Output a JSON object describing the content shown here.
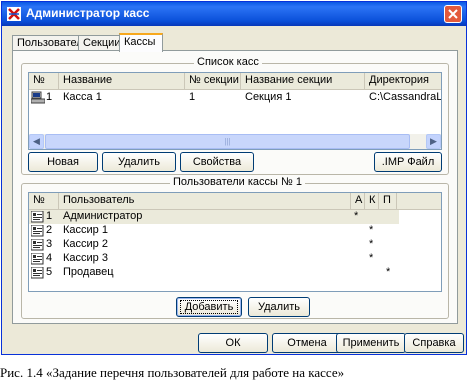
{
  "window": {
    "title": "Администратор касс"
  },
  "tabs": [
    {
      "label": "Пользователи"
    },
    {
      "label": "Секции"
    },
    {
      "label": "Кассы"
    }
  ],
  "kassy_group": {
    "title": "Список касс",
    "columns": [
      "№",
      "Название",
      "№ секции",
      "Название секции",
      "Директория"
    ],
    "rows": [
      {
        "num": "1",
        "name": "Касса 1",
        "section_num": "1",
        "section_name": "Секция 1",
        "directory": "C:\\CassandraLig"
      }
    ],
    "buttons": {
      "new": "Новая",
      "delete": "Удалить",
      "properties": "Свойства",
      "imp_file": ".IMP Файл"
    }
  },
  "users_group": {
    "title": "Пользователи кассы № 1",
    "columns": [
      "№",
      "Пользователь",
      "А",
      "К",
      "П"
    ],
    "rows": [
      {
        "num": "1",
        "name": "Администратор",
        "a": "*",
        "k": "",
        "p": ""
      },
      {
        "num": "2",
        "name": "Кассир 1",
        "a": "",
        "k": "*",
        "p": ""
      },
      {
        "num": "3",
        "name": "Кассир 2",
        "a": "",
        "k": "*",
        "p": ""
      },
      {
        "num": "4",
        "name": "Кассир 3",
        "a": "",
        "k": "*",
        "p": ""
      },
      {
        "num": "5",
        "name": "Продавец",
        "a": "",
        "k": "",
        "p": "*"
      }
    ],
    "buttons": {
      "add": "Добавить",
      "delete": "Удалить"
    }
  },
  "dialog_buttons": {
    "ok": "ОК",
    "cancel": "Отмена",
    "apply": "Применить",
    "help": "Справка"
  },
  "caption": "Рис. 1.4 «Задание перечня пользователей для работе на кассе»",
  "colors": {
    "titlebar": "#0a58e4",
    "selection": "#ebeadb",
    "face": "#ece9d8"
  }
}
